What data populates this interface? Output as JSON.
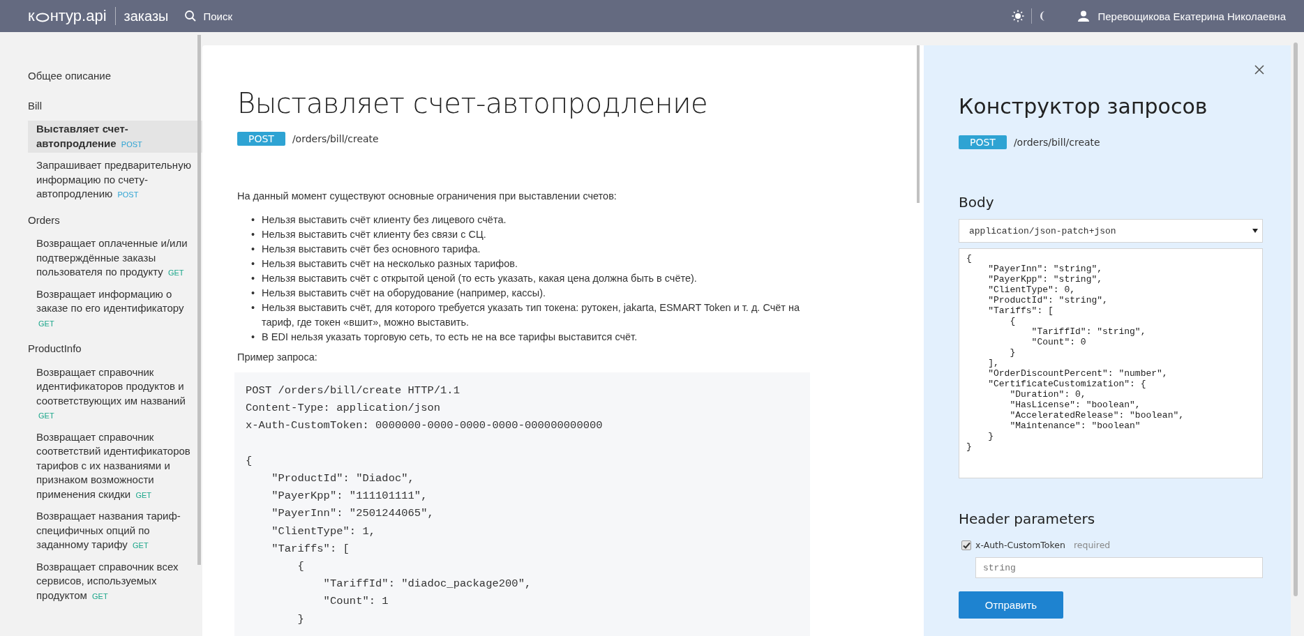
{
  "header": {
    "logo_start": "к",
    "logo_end": "нтур.api",
    "section": "заказы",
    "search_label": "Поиск",
    "user_name": "Перевощикова Екатерина Николаевна"
  },
  "sidebar": {
    "items": [
      {
        "label": "Общее описание",
        "selected": false
      },
      {
        "label": "Bill",
        "selected": false,
        "children": [
          {
            "label": "Выставляет счет-автопродление",
            "method": "POST",
            "color": "#2ea3d3",
            "selected": true
          },
          {
            "label": "Запрашивает предварительную информацию по счету-автопродлению",
            "method": "POST",
            "color": "#2ea3d3",
            "selected": false
          }
        ]
      },
      {
        "label": "Orders",
        "selected": false,
        "children": [
          {
            "label": "Возвращает оплаченные и/или подтверждённые заказы пользователя по продукту",
            "method": "GET",
            "color": "#1aa68a",
            "selected": false
          },
          {
            "label": "Возвращает информацию о заказе по его идентификатору",
            "method": "GET",
            "color": "#1aa68a",
            "selected": false
          }
        ]
      },
      {
        "label": "ProductInfo",
        "selected": false,
        "children": [
          {
            "label": "Возвращает справочник идентификаторов продуктов и соответствующих им названий",
            "method": "GET",
            "color": "#1aa68a",
            "selected": false
          },
          {
            "label": "Возвращает справочник соответствий идентификаторов тарифов с их названиями и признаком возможности применения скидки",
            "method": "GET",
            "color": "#1aa68a",
            "selected": false
          },
          {
            "label": "Возвращает названия тариф-специфичных опций по заданному тарифу",
            "method": "GET",
            "color": "#1aa68a",
            "selected": false
          },
          {
            "label": "Возвращает справочник всех сервисов, используемых продуктом",
            "method": "GET",
            "color": "#1aa68a",
            "selected": false
          }
        ]
      }
    ]
  },
  "article": {
    "title": "Выставляет счет-автопродление",
    "method": "POST",
    "path": "/orders/bill/create",
    "intro": "На данный момент существуют основные ограничения при выставлении счетов:",
    "bullets": [
      {
        "marker": "•",
        "text": "Нельзя выставить счёт клиенту без лицевого счёта."
      },
      {
        "marker": "•",
        "text": "Нельзя выставить счёт клиенту без связи с СЦ."
      },
      {
        "marker": "•",
        "text": "Нельзя выставить счёт без основного тарифа."
      },
      {
        "marker": "•",
        "text": "Нельзя выставить счёт на несколько разных тарифов."
      },
      {
        "marker": "•",
        "text": "Нельзя выставить счёт с открытой ценой (то есть указать, какая цена должна быть в счёте)."
      },
      {
        "marker": "•",
        "text": "Нельзя выставить счёт на оборудование (например, кассы)."
      },
      {
        "marker": "•",
        "text": "Нельзя выставить счёт, для которого требуется указать тип токена: рутокен, jakarta, ESMART Token и т. д. Счёт на тариф, где токен «вшит», можно выставить."
      },
      {
        "marker": "•",
        "text": "В EDI нельзя указать торговую сеть, то есть не на все тарифы выставится счёт."
      }
    ],
    "example_label": "Пример запроса:",
    "example_code": "POST /orders/bill/create HTTP/1.1\nContent-Type: application/json\nx-Auth-CustomToken: 0000000-0000-0000-0000-000000000000\n\n{\n    \"ProductId\": \"Diadoc\",\n    \"PayerKpp\": \"111101111\",\n    \"PayerInn\": \"2501244065\",\n    \"ClientType\": 1,\n    \"Tariffs\": [\n        {\n            \"TariffId\": \"diadoc_package200\",\n            \"Count\": 1\n        }"
  },
  "request_builder": {
    "title": "Конструктор запросов",
    "method": "POST",
    "path": "/orders/bill/create",
    "body_heading": "Body",
    "content_type": "application/json-patch+json",
    "body": "{\n    \"PayerInn\": \"string\",\n    \"PayerKpp\": \"string\",\n    \"ClientType\": 0,\n    \"ProductId\": \"string\",\n    \"Tariffs\": [\n        {\n            \"TariffId\": \"string\",\n            \"Count\": 0\n        }\n    ],\n    \"OrderDiscountPercent\": \"number\",\n    \"CertificateCustomization\": {\n        \"Duration\": 0,\n        \"HasLicense\": \"boolean\",\n        \"AcceleratedRelease\": \"boolean\",\n        \"Maintenance\": \"boolean\"\n    }\n}",
    "headers_heading": "Header parameters",
    "header_params": [
      {
        "name": "x-Auth-CustomToken",
        "note": "required",
        "checked": true,
        "placeholder": "string"
      }
    ],
    "submit": "Отправить"
  }
}
